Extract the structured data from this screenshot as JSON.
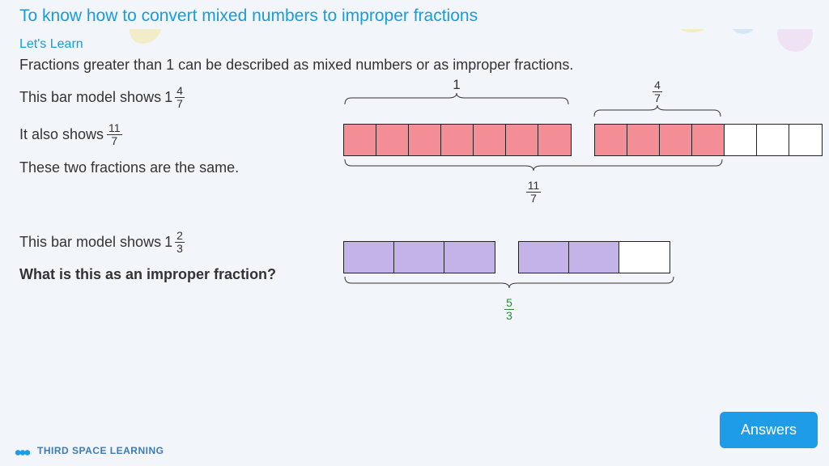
{
  "header": {
    "title": "To know how to convert mixed numbers to improper fractions",
    "subtitle": "Let's Learn"
  },
  "content": {
    "intro": "Fractions greater than 1 can be described as mixed numbers or as improper fractions.",
    "line1_prefix": "This bar model shows",
    "mixed1_whole": "1",
    "mixed1_num": "4",
    "mixed1_den": "7",
    "line2_prefix": "It also shows",
    "improper1_num": "11",
    "improper1_den": "7",
    "line3": "These two fractions are the same.",
    "section2_prefix": "This bar model shows",
    "mixed2_whole": "1",
    "mixed2_num": "2",
    "mixed2_den": "3",
    "question": "What is this as an improper fraction?"
  },
  "diagram1": {
    "top_label_left": "1",
    "top_frac_num": "4",
    "top_frac_den": "7",
    "bottom_frac_num": "11",
    "bottom_frac_den": "7",
    "bar1_segments": 7,
    "bar1_filled": 7,
    "bar2_segments": 7,
    "bar2_filled": 4,
    "fill_color": "pink"
  },
  "diagram2": {
    "bottom_frac_num": "5",
    "bottom_frac_den": "3",
    "bar1_segments": 3,
    "bar1_filled": 3,
    "bar2_segments": 3,
    "bar2_filled": 2,
    "fill_color": "purple"
  },
  "buttons": {
    "answers": "Answers"
  },
  "footer": {
    "brand": "THIRD SPACE LEARNING"
  },
  "chart_data": [
    {
      "type": "bar",
      "title": "Bar model for 1 4/7 = 11/7",
      "categories": [
        "bar1",
        "bar2"
      ],
      "series": [
        {
          "name": "segments_total",
          "values": [
            7,
            7
          ]
        },
        {
          "name": "segments_filled",
          "values": [
            7,
            4
          ]
        }
      ],
      "labels": {
        "top_left": "1",
        "top_right": "4/7",
        "bottom": "11/7"
      }
    },
    {
      "type": "bar",
      "title": "Bar model for 1 2/3 = 5/3",
      "categories": [
        "bar1",
        "bar2"
      ],
      "series": [
        {
          "name": "segments_total",
          "values": [
            3,
            3
          ]
        },
        {
          "name": "segments_filled",
          "values": [
            3,
            2
          ]
        }
      ],
      "labels": {
        "bottom": "5/3"
      }
    }
  ]
}
